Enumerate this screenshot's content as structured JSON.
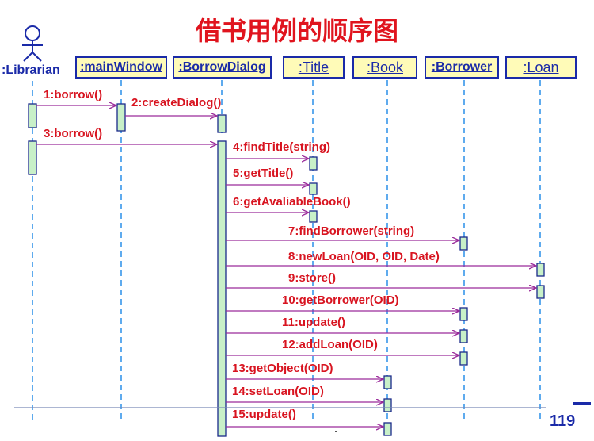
{
  "title": "借书用例的顺序图",
  "actor": {
    "label": ":Librarian"
  },
  "objects": [
    {
      "label": ":mainWindow"
    },
    {
      "label": ":BorrowDialog"
    },
    {
      "label": ":Title"
    },
    {
      "label": ":Book"
    },
    {
      "label": ":Borrower"
    },
    {
      "label": ":Loan"
    }
  ],
  "messages": [
    {
      "label": "1:borrow()",
      "from": "Librarian",
      "to": "mainWindow"
    },
    {
      "label": "2:createDialog()",
      "from": "mainWindow",
      "to": "BorrowDialog"
    },
    {
      "label": "3:borrow()",
      "from": "Librarian",
      "to": "BorrowDialog"
    },
    {
      "label": "4:findTitle(string)",
      "from": "BorrowDialog",
      "to": "Title"
    },
    {
      "label": "5:getTitle()",
      "from": "BorrowDialog",
      "to": "Title"
    },
    {
      "label": "6:getAvaliableBook()",
      "from": "BorrowDialog",
      "to": "Title"
    },
    {
      "label": "7:findBorrower(string)",
      "from": "BorrowDialog",
      "to": "Borrower"
    },
    {
      "label": "8:newLoan(OID, OID, Date)",
      "from": "BorrowDialog",
      "to": "Loan"
    },
    {
      "label": "9:store()",
      "from": "BorrowDialog",
      "to": "Loan"
    },
    {
      "label": "10:getBorrower(OID)",
      "from": "BorrowDialog",
      "to": "Borrower"
    },
    {
      "label": "11:update()",
      "from": "BorrowDialog",
      "to": "Borrower"
    },
    {
      "label": "12:addLoan(OID)",
      "from": "BorrowDialog",
      "to": "Borrower"
    },
    {
      "label": "13:getObject(OID)",
      "from": "BorrowDialog",
      "to": "Book"
    },
    {
      "label": "14:setLoan(OID)",
      "from": "BorrowDialog",
      "to": "Book"
    },
    {
      "label": "15:update()",
      "from": "BorrowDialog",
      "to": "Book"
    }
  ],
  "page_number": "119",
  "colors": {
    "title": "#e0141e",
    "object_fill": "#fffbb8",
    "object_border": "#1a2aa8",
    "lifeline": "#2a8fe8",
    "activation": "#c8f0c8",
    "arrow": "#9a2a9a",
    "message_text": "#d81420"
  }
}
